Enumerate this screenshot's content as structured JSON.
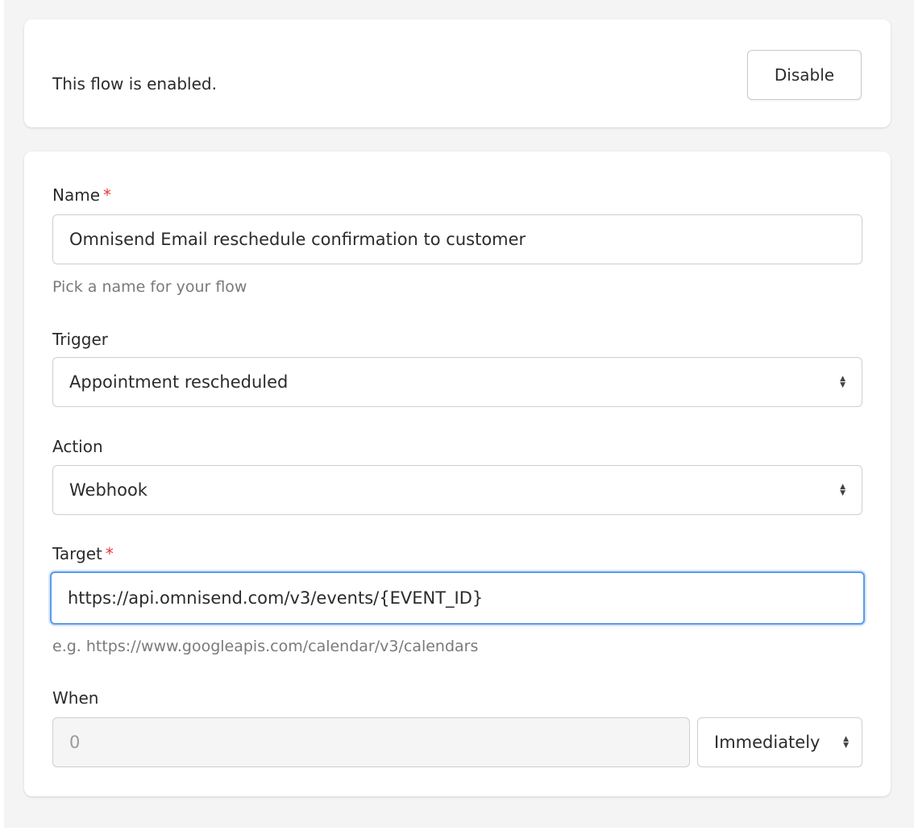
{
  "status": {
    "text": "This flow is enabled.",
    "disable_label": "Disable"
  },
  "form": {
    "name": {
      "label": "Name",
      "required_mark": "*",
      "value": "Omnisend Email reschedule confirmation to customer",
      "hint": "Pick a name for your flow"
    },
    "trigger": {
      "label": "Trigger",
      "value": "Appointment rescheduled",
      "icon": "sort-caret-icon"
    },
    "action": {
      "label": "Action",
      "value": "Webhook",
      "icon": "sort-caret-icon"
    },
    "target": {
      "label": "Target",
      "required_mark": "*",
      "value": "https://api.omnisend.com/v3/events/{EVENT_ID}",
      "hint": "e.g. https://www.googleapis.com/calendar/v3/calendars"
    },
    "when": {
      "label": "When",
      "value": "0",
      "unit": "Immediately",
      "icon": "sort-caret-icon"
    }
  },
  "colors": {
    "required": "#e53935",
    "focus_border": "#5b9be6",
    "page_bg": "#f4f4f5"
  }
}
